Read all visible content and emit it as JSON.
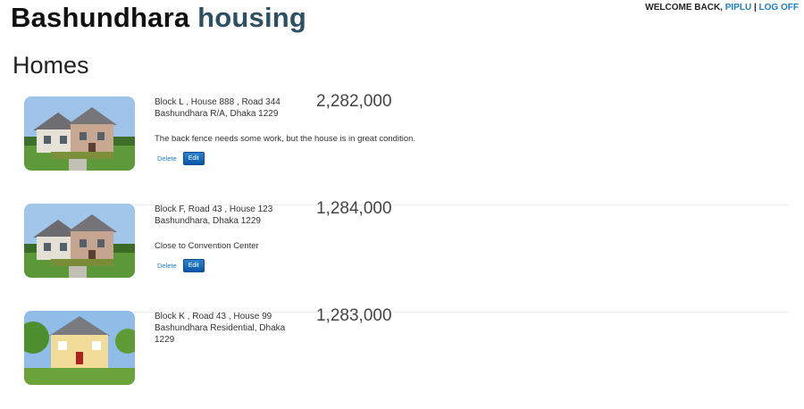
{
  "header": {
    "brand_main": "Bashundhara",
    "brand_accent": "housing",
    "welcome_prefix": "WELCOME BACK, ",
    "username": "PIPLU",
    "separator": " | ",
    "logoff_label": "LOG OFF"
  },
  "page": {
    "title": "Homes"
  },
  "listings": [
    {
      "address_line1": "Block L , House 888 , Road 344",
      "address_line2": "Bashundhara R/A, Dhaka 1229",
      "price": "2,282,000",
      "description": "The back fence needs some work, but the house is in great condition.",
      "delete_label": "Delete",
      "edit_label": "Edit"
    },
    {
      "address_line1": "Block F, Road 43 , House 123",
      "address_line2": "Bashundhara, Dhaka 1229",
      "price": "1,284,000",
      "description": "Close to Convention Center",
      "delete_label": "Delete",
      "edit_label": "Edit"
    },
    {
      "address_line1": "Block K , Road 43 , House 99",
      "address_line2": "Bashundhara Residential, Dhaka 1229",
      "price": "1,283,000",
      "description": "",
      "delete_label": "",
      "edit_label": ""
    }
  ],
  "colors": {
    "accent": "#2f4f62",
    "link": "#1c7fc2",
    "button": "#0a56a8"
  }
}
